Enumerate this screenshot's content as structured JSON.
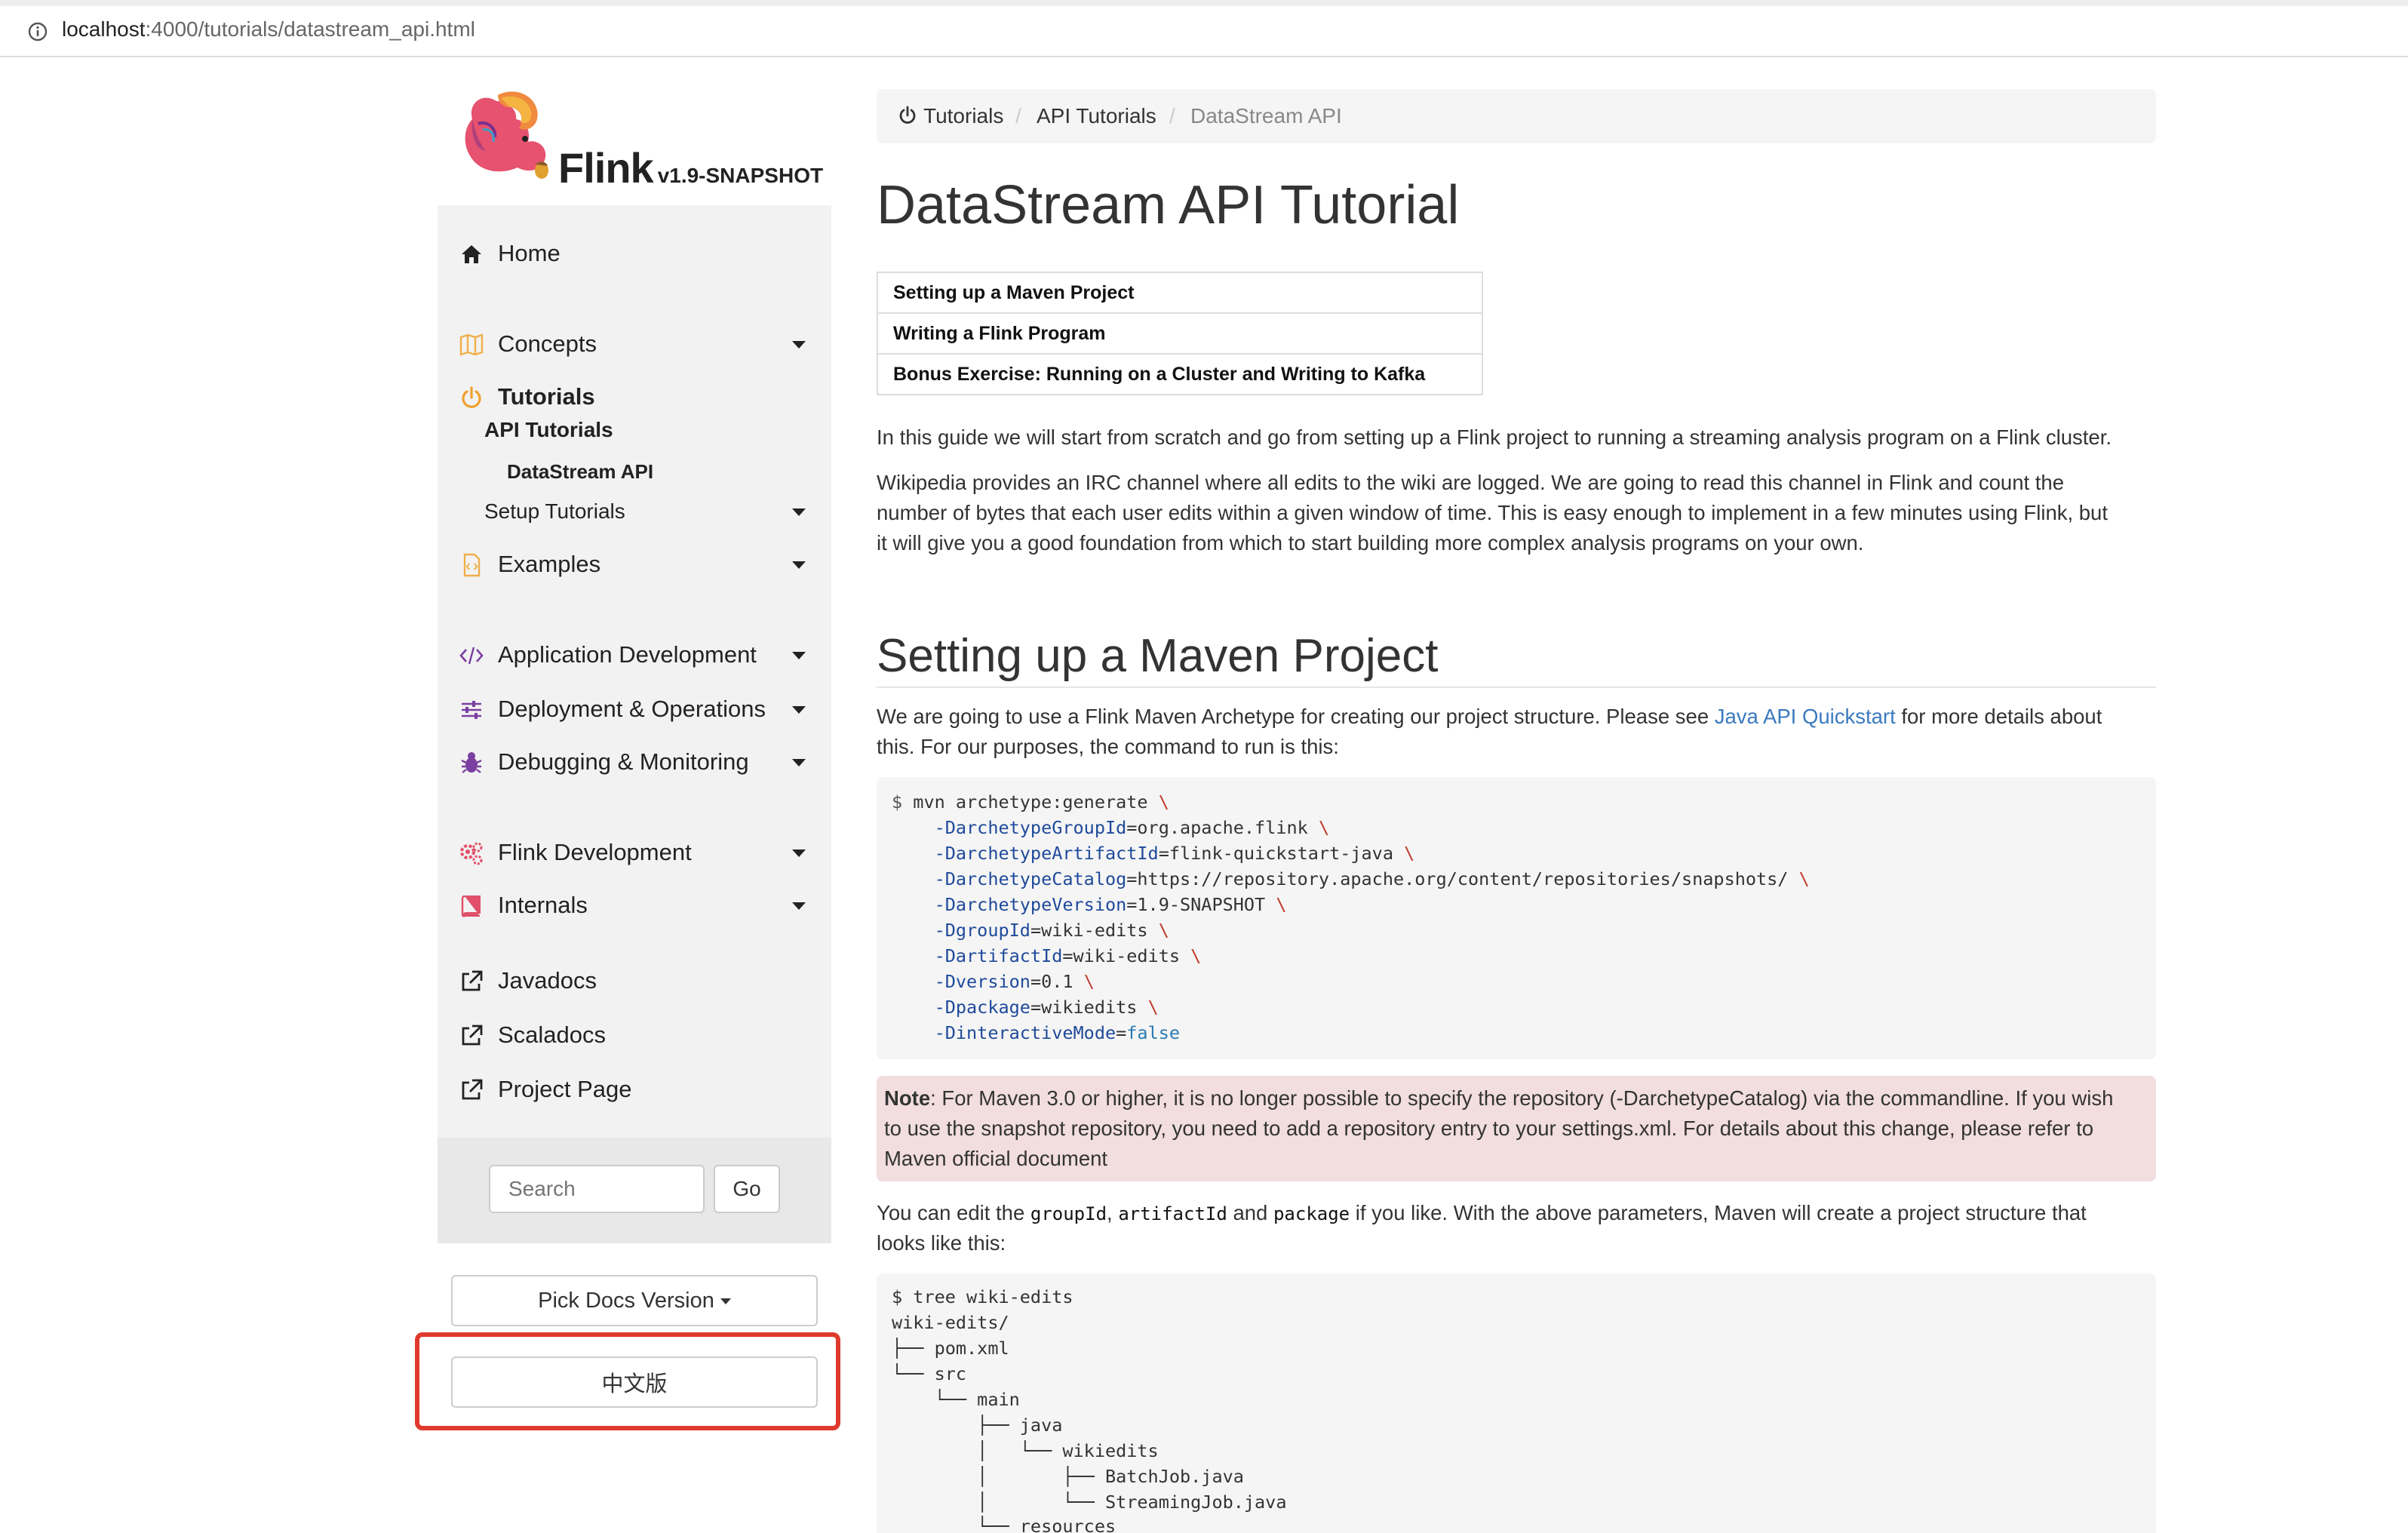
{
  "browser": {
    "url_host": "localhost",
    "url_path": ":4000/tutorials/datastream_api.html"
  },
  "brand": {
    "name": "Flink",
    "version": "v1.9-SNAPSHOT"
  },
  "sidebar": {
    "items": [
      {
        "label": "Home",
        "icon": "home-icon"
      },
      {
        "label": "Concepts",
        "icon": "map-icon"
      },
      {
        "label": "Tutorials",
        "icon": "power-icon"
      },
      {
        "label": "Examples",
        "icon": "file-code-icon"
      },
      {
        "label": "Application Development",
        "icon": "code-icon"
      },
      {
        "label": "Deployment & Operations",
        "icon": "sliders-icon"
      },
      {
        "label": "Debugging & Monitoring",
        "icon": "bug-icon"
      },
      {
        "label": "Flink Development",
        "icon": "gears-icon"
      },
      {
        "label": "Internals",
        "icon": "book-icon"
      },
      {
        "label": "Javadocs",
        "icon": "external-link-icon"
      },
      {
        "label": "Scaladocs",
        "icon": "external-link-icon"
      },
      {
        "label": "Project Page",
        "icon": "external-link-icon"
      }
    ],
    "sub": {
      "api_tutorials": "API Tutorials",
      "datastream_api": "DataStream API",
      "setup_tutorials": "Setup Tutorials"
    },
    "search_placeholder": "Search",
    "go": "Go",
    "pick_version": "Pick Docs Version",
    "chinese": "中文版"
  },
  "breadcrumb": [
    "Tutorials",
    "API Tutorials",
    "DataStream API"
  ],
  "page_title": "DataStream API Tutorial",
  "toc": [
    "Setting up a Maven Project",
    "Writing a Flink Program",
    "Bonus Exercise: Running on a Cluster and Writing to Kafka"
  ],
  "intro": {
    "p1": "In this guide we will start from scratch and go from setting up a Flink project to running a streaming analysis program on a Flink cluster.",
    "p2_l1": "Wikipedia provides an IRC channel where all edits to the wiki are logged. We are going to read this channel in Flink and count the",
    "p2_l2": "number of bytes that each user edits within a given window of time. This is easy enough to implement in a few minutes using Flink, but",
    "p2_l3": "it will give you a good foundation from which to start building more complex analysis programs on your own."
  },
  "section_title": "Setting up a Maven Project",
  "section": {
    "p1_a": "We are going to use a Flink Maven Archetype for creating our project structure. Please see ",
    "p1_link": "Java API Quickstart",
    "p1_b": " for more details about",
    "p1_l2": "this. For our purposes, the command to run is this:",
    "cmd": {
      "prompt": "$",
      "first": " mvn archetype:generate ",
      "bs": "\\",
      "params": [
        {
          "k": "-DarchetypeGroupId",
          "v": "=org.apache.flink "
        },
        {
          "k": "-DarchetypeArtifactId",
          "v": "=flink-quickstart-java "
        },
        {
          "k": "-DarchetypeCatalog",
          "v": "=https://repository.apache.org/content/repositories/snapshots/ "
        },
        {
          "k": "-DarchetypeVersion",
          "v": "=1.9-SNAPSHOT "
        },
        {
          "k": "-DgroupId",
          "v": "=wiki-edits "
        },
        {
          "k": "-DartifactId",
          "v": "=wiki-edits "
        },
        {
          "k": "-Dversion",
          "v": "=0.1 "
        },
        {
          "k": "-Dpackage",
          "v": "=wikiedits "
        }
      ],
      "last_k": "-DinteractiveMode",
      "last_eq": "=",
      "last_v": "false"
    },
    "note": {
      "strong": "Note",
      "l1": ": For Maven 3.0 or higher, it is no longer possible to specify the repository (-DarchetypeCatalog) via the commandline. If you wish",
      "l2": "to use the snapshot repository, you need to add a repository entry to your settings.xml. For details about this change, please refer to",
      "link": "Maven official document"
    },
    "p2_a": "You can edit the ",
    "p2_c1": "groupId",
    "p2_b": ", ",
    "p2_c2": "artifactId",
    "p2_c": " and ",
    "p2_c3": "package",
    "p2_d": " if you like. With the above parameters, Maven will create a project structure that",
    "p2_l2": "looks like this:",
    "tree": [
      "$ tree wiki-edits",
      "wiki-edits/",
      "├── pom.xml",
      "└── src",
      "    └── main",
      "        ├── java",
      "        │   └── wikiedits",
      "        │       ├── BatchJob.java",
      "        │       └── StreamingJob.java",
      "        └── resources"
    ]
  }
}
